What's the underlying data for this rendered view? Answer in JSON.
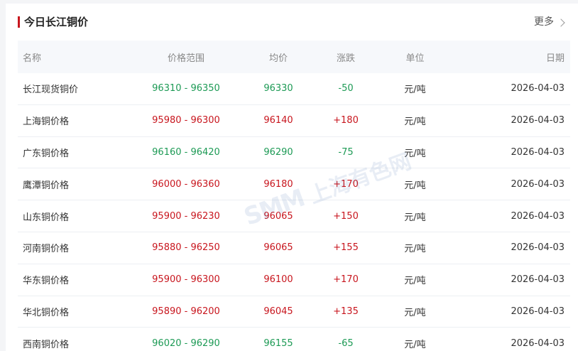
{
  "header": {
    "title": "今日长江铜价",
    "more_label": "更多"
  },
  "columns": {
    "name": "名称",
    "range": "价格范围",
    "avg": "均价",
    "change": "涨跌",
    "unit": "单位",
    "date": "日期"
  },
  "rows": [
    {
      "name": "长江现货铜价",
      "range": "96310 - 96350",
      "avg": "96330",
      "change": "-50",
      "unit": "元/吨",
      "date": "2026-04-03",
      "trend": "down"
    },
    {
      "name": "上海铜价格",
      "range": "95980 - 96300",
      "avg": "96140",
      "change": "+180",
      "unit": "元/吨",
      "date": "2026-04-03",
      "trend": "up"
    },
    {
      "name": "广东铜价格",
      "range": "96160 - 96420",
      "avg": "96290",
      "change": "-75",
      "unit": "元/吨",
      "date": "2026-04-03",
      "trend": "down"
    },
    {
      "name": "鹰潭铜价格",
      "range": "96000 - 96360",
      "avg": "96180",
      "change": "+170",
      "unit": "元/吨",
      "date": "2026-04-03",
      "trend": "up"
    },
    {
      "name": "山东铜价格",
      "range": "95900 - 96230",
      "avg": "96065",
      "change": "+150",
      "unit": "元/吨",
      "date": "2026-04-03",
      "trend": "up"
    },
    {
      "name": "河南铜价格",
      "range": "95880 - 96250",
      "avg": "96065",
      "change": "+155",
      "unit": "元/吨",
      "date": "2026-04-03",
      "trend": "up"
    },
    {
      "name": "华东铜价格",
      "range": "95900 - 96300",
      "avg": "96100",
      "change": "+170",
      "unit": "元/吨",
      "date": "2026-04-03",
      "trend": "up"
    },
    {
      "name": "华北铜价格",
      "range": "95890 - 96200",
      "avg": "96045",
      "change": "+135",
      "unit": "元/吨",
      "date": "2026-04-03",
      "trend": "up"
    },
    {
      "name": "西南铜价格",
      "range": "96020 - 96290",
      "avg": "96155",
      "change": "-65",
      "unit": "元/吨",
      "date": "2026-04-03",
      "trend": "down"
    }
  ],
  "watermark": {
    "logo": "SMM",
    "text": "上海有色网"
  },
  "colors": {
    "accent": "#c8161e",
    "up": "#c8161e",
    "down": "#1d9a55"
  }
}
